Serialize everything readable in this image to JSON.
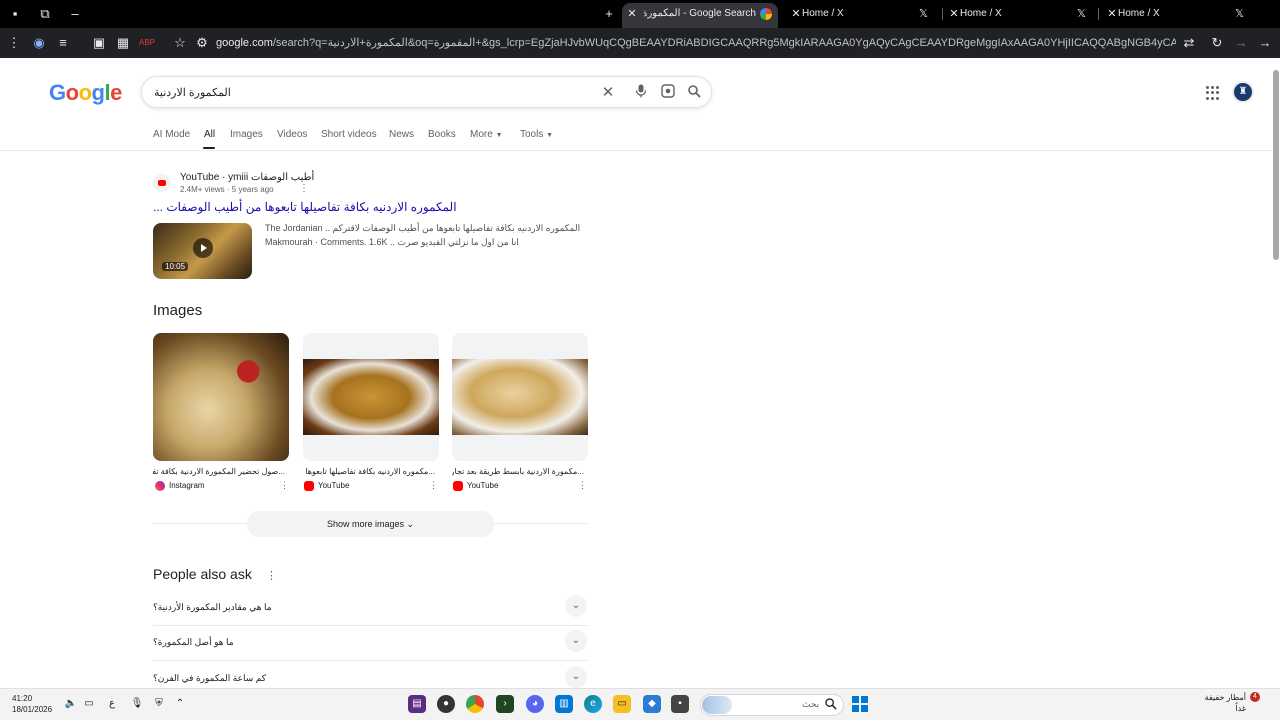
{
  "browser": {
    "tabs": [
      {
        "title": "Google Search - المكمورة الاردنية",
        "active": true
      },
      {
        "title": "Home / X",
        "active": false
      },
      {
        "title": "Home / X",
        "active": false
      },
      {
        "title": "Home / X",
        "active": false
      }
    ],
    "new_tab_label": "+",
    "url_host": "google.com",
    "url_rest": "/search?q=المكمورة+الاردنية&oq=المقمورة+&gs_lcrp=EgZjaHJvbWUqCQgBEAAYDRiABDIGCAAQRRg5MgkIARAAGA0YgAQyCAgCEAAYDRgeMggIAxAAGA0YHjIICAQQABgNGB4yCAgFEAAYDRgeMggIBhAAGA0YHjIICAcQAB..."
  },
  "google": {
    "logo": "Google",
    "query": "المكمورة الاردنية",
    "nav": [
      "AI Mode",
      "All",
      "Images",
      "Videos",
      "Short videos",
      "News",
      "Books",
      "More",
      "Tools"
    ],
    "nav_active": "All"
  },
  "video_result": {
    "site": "YouTube · ymiii أطيب الوصفات",
    "meta": "2.4M+ views · 5 years ago",
    "title": "المكموره الاردنيه بكافة تفاصيلها تابعوها من أطيب الوصفات ...",
    "duration": "10:05",
    "desc_line1": "The Jordanian .. المكموره الاردنيه بكافة تفاصيلها تابعوها من أطيب الوصفات لاقتركم",
    "desc_line2": "Makmourah · Comments. 1.6K  .. انا من اول ما نزلتي الفيديو صرت"
  },
  "images": {
    "heading": "Images",
    "items": [
      {
        "caption": "...صول تحضير المكمورة الاردنية بكافة تفا",
        "source": "Instagram",
        "source_icon": "instagram-icon"
      },
      {
        "caption": "...مكموره الاردنيه بكافة تفاصيلها تابعوها من",
        "source": "YouTube",
        "source_icon": "youtube-icon"
      },
      {
        "caption": "...مكمورة الاردنية بأبسط طريقة بعد تجارب",
        "source": "YouTube",
        "source_icon": "youtube-icon"
      }
    ],
    "more_label": "Show more images"
  },
  "paa": {
    "heading": "People also ask",
    "questions": [
      "ما هي مقادير المكمورة الأردنية؟",
      "ما هو أصل المكمورة؟",
      "كم ساعة المكمورة في الفرن؟"
    ]
  },
  "taskbar": {
    "time": "41:20",
    "date": "18/01/2026",
    "lang": "ع",
    "search_placeholder": "بحث",
    "weather": "أمطار خفيفة",
    "weather_sub": "غداً",
    "notification_count": "4"
  }
}
